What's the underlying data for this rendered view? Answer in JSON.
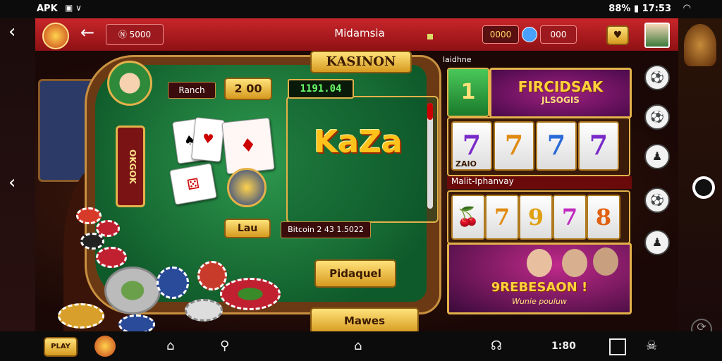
{
  "status_bar": {
    "app_label": "APK",
    "right_text": "88% ▮ 17:53"
  },
  "header": {
    "back_glyph": "‹",
    "nav_back_glyph": "←",
    "left_button_label": "Ⓝ 5000",
    "title": "Midamsia",
    "coins": "0000",
    "gems": "000",
    "favorite_glyph": "♥"
  },
  "table": {
    "title": "KASINON",
    "player_name": "Ranch",
    "bet_value": "2 00",
    "timer_display": "1191.04",
    "side_banner": "OKGOK",
    "bet_label": "Lau",
    "game_title": "KaZa",
    "win_info": "Bitcoin 2 43 1.5022",
    "primary_button": "Pidaquel",
    "bottom_button": "Mawes"
  },
  "right_panel": {
    "top_label": "laidhne",
    "rank_number": "1",
    "promo_title": "FIRCIDSAK",
    "promo_subtitle": "JLSOGIS",
    "slot_top_symbols": [
      "7",
      "7",
      "7",
      "7"
    ],
    "slot_top_caption": "ZAIO",
    "slot_section_label": "Malit-Iphanvay",
    "slot_bottom_symbols": [
      "🍒",
      "7",
      "9",
      "7",
      "8"
    ],
    "promo2_title": "9REBESAON !",
    "promo2_subtitle": "Wunie pouluw"
  },
  "side_icons": [
    "⚽",
    "⚽",
    "♟",
    "⚽",
    "♟"
  ],
  "nav_bar": {
    "left_badge": "PLAY",
    "counter_text": "1:80"
  },
  "colors": {
    "header_red": "#c8262a",
    "felt_green": "#1e7a3a",
    "gold": "#e4b24a"
  }
}
